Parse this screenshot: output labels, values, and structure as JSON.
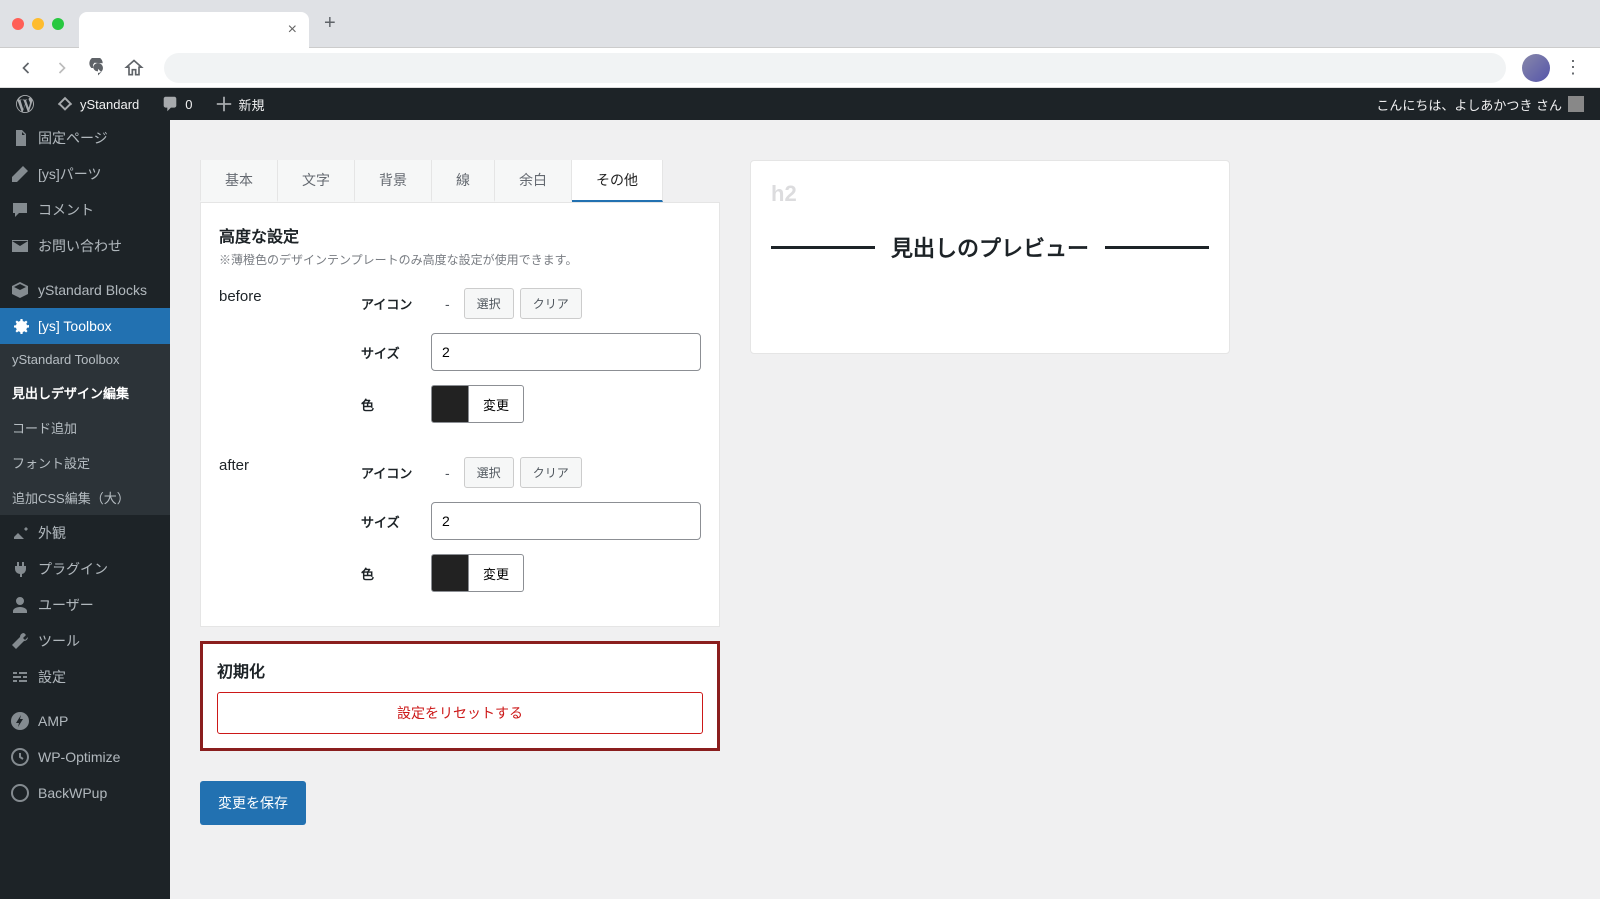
{
  "admin_bar": {
    "site_name": "yStandard",
    "comments": "0",
    "new": "新規",
    "greeting": "こんにちは、よしあかつき さん"
  },
  "sidebar": {
    "items": [
      {
        "label": "固定ページ"
      },
      {
        "label": "[ys]パーツ"
      },
      {
        "label": "コメント"
      },
      {
        "label": "お問い合わせ"
      },
      {
        "label": "yStandard Blocks"
      },
      {
        "label": "[ys] Toolbox"
      },
      {
        "label": "外観"
      },
      {
        "label": "プラグイン"
      },
      {
        "label": "ユーザー"
      },
      {
        "label": "ツール"
      },
      {
        "label": "設定"
      },
      {
        "label": "AMP"
      },
      {
        "label": "WP-Optimize"
      },
      {
        "label": "BackWPup"
      }
    ],
    "submenu": [
      {
        "label": "yStandard Toolbox"
      },
      {
        "label": "見出しデザイン編集"
      },
      {
        "label": "コード追加"
      },
      {
        "label": "フォント設定"
      },
      {
        "label": "追加CSS編集（大）"
      }
    ]
  },
  "tabs": [
    {
      "label": "基本"
    },
    {
      "label": "文字"
    },
    {
      "label": "背景"
    },
    {
      "label": "線"
    },
    {
      "label": "余白"
    },
    {
      "label": "その他"
    }
  ],
  "panel": {
    "title": "高度な設定",
    "note": "※薄橙色のデザインテンプレートのみ高度な設定が使用できます。",
    "before_label": "before",
    "after_label": "after",
    "icon_label": "アイコン",
    "icon_value": "-",
    "select_btn": "選択",
    "clear_btn": "クリア",
    "size_label": "サイズ",
    "size_value_before": "2",
    "size_value_after": "2",
    "color_label": "色",
    "change_btn": "変更"
  },
  "reset": {
    "title": "初期化",
    "button": "設定をリセットする"
  },
  "save_btn": "変更を保存",
  "preview": {
    "tag": "h2",
    "text": "見出しのプレビュー"
  }
}
